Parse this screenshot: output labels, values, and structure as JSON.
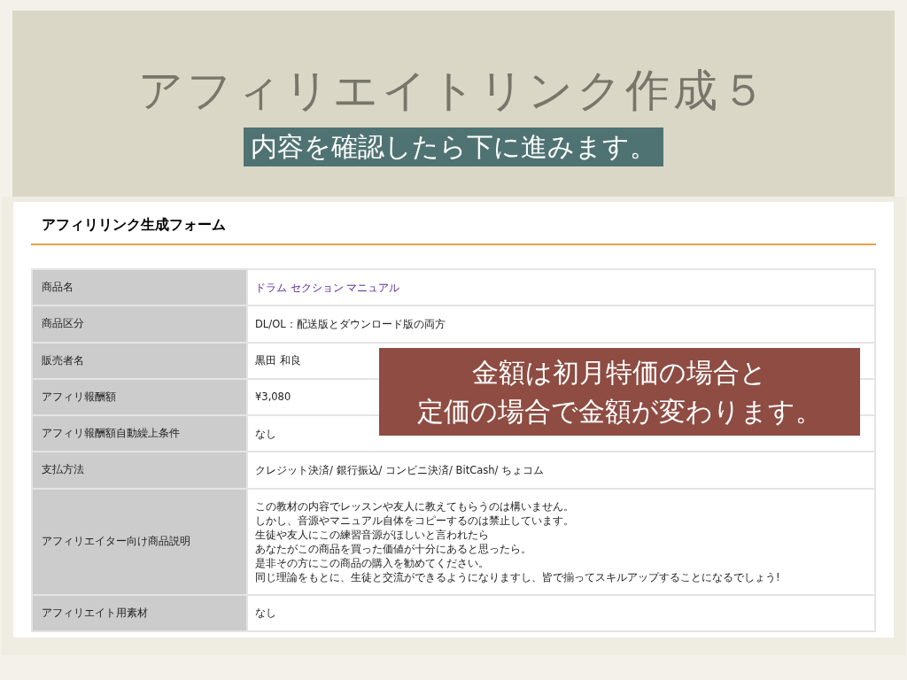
{
  "slide": {
    "title": "アフィリエイトリンク作成５",
    "subtitle": "内容を確認したら下に進みます。"
  },
  "form": {
    "heading": "アフィリリンク生成フォーム",
    "rows": [
      {
        "label": "商品名",
        "kind": "link",
        "value": [
          "ドラム セクション マニュアル"
        ]
      },
      {
        "label": "商品区分",
        "kind": "text",
        "value": [
          "DL/OL：配送版とダウンロード版の両方"
        ]
      },
      {
        "label": "販売者名",
        "kind": "text",
        "value": [
          "黒田 和良"
        ]
      },
      {
        "label": "アフィリ報酬額",
        "kind": "text",
        "value": [
          "¥3,080"
        ]
      },
      {
        "label": "アフィリ報酬額自動繰上条件",
        "kind": "text",
        "value": [
          "なし"
        ]
      },
      {
        "label": "支払方法",
        "kind": "text",
        "value": [
          "クレジット決済/ 銀行振込/ コンビニ決済/ BitCash/ ちょコム"
        ]
      },
      {
        "label": "アフィリエイター向け商品説明",
        "kind": "text",
        "value": [
          "この教材の内容でレッスンや友人に教えてもらうのは構いません。",
          "しかし、音源やマニュアル自体をコピーするのは禁止しています。",
          "生徒や友人にこの練習音源がほしいと言われたら",
          "あなたがこの商品を買った価値が十分にあると思ったら。",
          "是非その方にこの商品の購入を勧めてください。",
          "同じ理論をもとに、生徒と交流ができるようになりますし、皆で揃ってスキルアップすることになるでしょう!"
        ]
      },
      {
        "label": "アフィリエイト用素材",
        "kind": "text",
        "value": [
          "なし"
        ]
      }
    ]
  },
  "callout": {
    "lines": [
      "金額は初月特価の場合と",
      "定価の場合で金額が変わります。"
    ]
  }
}
